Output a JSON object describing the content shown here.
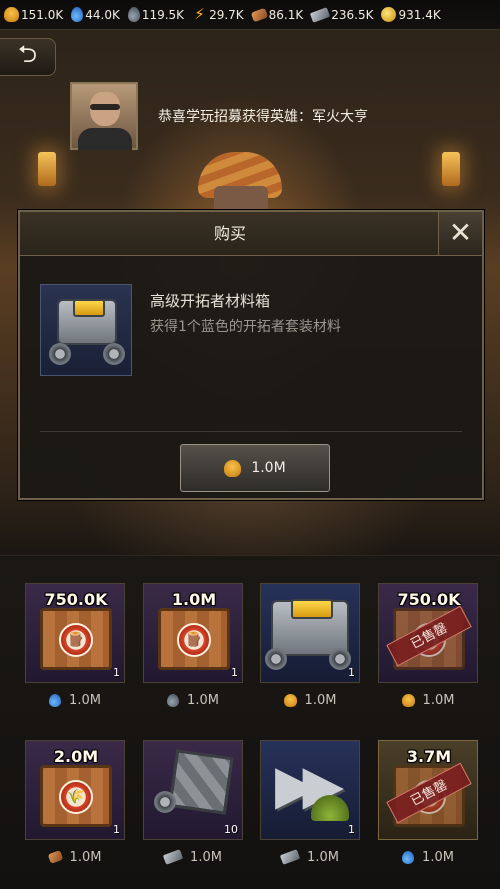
{
  "resources": [
    {
      "icon": "wheat-icon",
      "value": "151.0K"
    },
    {
      "icon": "water-drop-icon",
      "value": "44.0K"
    },
    {
      "icon": "oil-drop-icon",
      "value": "119.5K"
    },
    {
      "icon": "electricity-icon",
      "value": "29.7K"
    },
    {
      "icon": "wood-icon",
      "value": "86.1K"
    },
    {
      "icon": "steel-icon",
      "value": "236.5K"
    },
    {
      "icon": "gold-coin-icon",
      "value": "931.4K"
    }
  ],
  "back_label": "⮌",
  "notice": {
    "text": "恭喜学玩招募获得英雄：军火大亨"
  },
  "dialog": {
    "title": "购买",
    "close_label": "✕",
    "item_title": "高级开拓者材料箱",
    "item_desc": "获得1个蓝色的开拓者套装材料",
    "price": "1.0M",
    "price_icon": "wheat-icon"
  },
  "shop": [
    {
      "amount": "750.0K",
      "qty": "1",
      "price": "1.0M",
      "price_icon": "water-drop-icon",
      "sold_out": "",
      "art": "wood-crate"
    },
    {
      "amount": "1.0M",
      "qty": "1",
      "price": "1.0M",
      "price_icon": "oil-drop-icon",
      "sold_out": "",
      "art": "wood-crate"
    },
    {
      "amount": "",
      "qty": "1",
      "price": "1.0M",
      "price_icon": "wheat-icon",
      "sold_out": "",
      "art": "pioneer-crate"
    },
    {
      "amount": "750.0K",
      "qty": "",
      "price": "1.0M",
      "price_icon": "wheat-icon",
      "sold_out": "已售罄",
      "art": "wood-crate"
    },
    {
      "amount": "2.0M",
      "qty": "1",
      "price": "1.0M",
      "price_icon": "wood-icon",
      "sold_out": "",
      "art": "wheat-crate"
    },
    {
      "amount": "",
      "qty": "10",
      "price": "1.0M",
      "price_icon": "steel-icon",
      "sold_out": "",
      "art": "steel-crate"
    },
    {
      "amount": "",
      "qty": "1",
      "price": "1.0M",
      "price_icon": "steel-icon",
      "sold_out": "",
      "art": "speedup"
    },
    {
      "amount": "3.7M",
      "qty": "",
      "price": "1.0M",
      "price_icon": "water-drop-icon",
      "sold_out": "已售罄",
      "art": "bolt-crate"
    }
  ],
  "colors": {
    "wheat": "#f8c34a",
    "water": "#3a8de0",
    "sold_out": "#7a1e1e",
    "dialog_border": "#6e6049"
  }
}
